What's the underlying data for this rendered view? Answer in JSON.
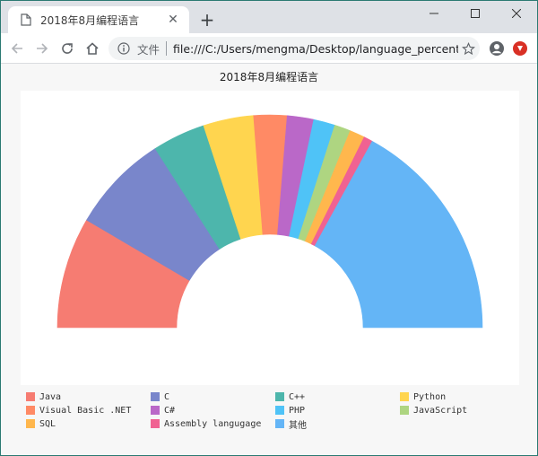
{
  "browser": {
    "tab_title": "2018年8月编程语言",
    "new_tab_symbol": "+",
    "tab_close_symbol": "✕",
    "omnibox_scheme_label": "文件",
    "url": "file:///C:/Users/mengma/Desktop/language_percent.s..."
  },
  "page": {
    "chart_title": "2018年8月编程语言"
  },
  "chart_data": {
    "type": "pie",
    "variant": "half-donut",
    "title": "2018年8月编程语言",
    "start_angle_deg": 180,
    "end_angle_deg": 0,
    "categories": [
      "Java",
      "C",
      "C++",
      "Python",
      "Visual Basic .NET",
      "C#",
      "PHP",
      "JavaScript",
      "SQL",
      "Assembly langugage",
      "其他"
    ],
    "values": [
      16.88,
      14.97,
      8.04,
      7.66,
      5.05,
      4.03,
      3.27,
      2.45,
      2.3,
      1.36,
      34.0
    ],
    "colors": [
      "#f67c72",
      "#7986cb",
      "#4db6ac",
      "#ffd54f",
      "#ff8a65",
      "#ba68c8",
      "#4fc3f7",
      "#aed581",
      "#ffb74d",
      "#f06292",
      "#64b5f6"
    ],
    "legend_position": "bottom",
    "grid": false
  }
}
